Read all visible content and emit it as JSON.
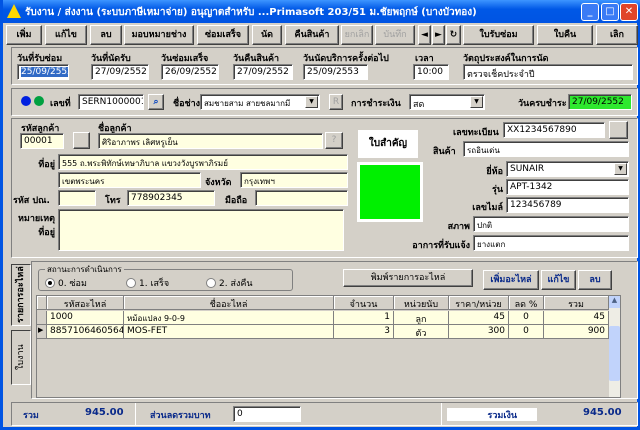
{
  "window": {
    "title": "รับงาน / ส่งงาน (ระบบภาษีเหมาจ่าย) อนุญาตสำหรับ ...Primasoft 203/51 ม.ชัยพฤกษ์ (บางบัวทอง)"
  },
  "toolbar": {
    "add": "เพิ่ม",
    "edit": "แก้ไข",
    "delete": "ลบ",
    "assign_tech": "มอบหมายช่าง",
    "repair_done": "ซ่อมเสร็จ",
    "appointment": "นัด",
    "return_goods": "คืนสินค้า",
    "cancel": "ยกเลิก",
    "save": "บันทึก",
    "prev": "◄",
    "next": "►",
    "refresh": "↻",
    "repair_receipt": "ใบรับซ่อม",
    "return_receipt": "ใบคืน",
    "quit": "เลิก"
  },
  "dates": {
    "received_label": "วันที่รับซ่อม",
    "received": "25/09/2552",
    "pickup_label": "วันที่นัดรับ",
    "pickup": "27/09/2552",
    "repaired_label": "วันซ่อมเสร็จ",
    "repaired": "26/09/2552",
    "returned_label": "วันคืนสินค้า",
    "returned": "27/09/2552",
    "next_service_label": "วันนัดบริการครั้งต่อไป",
    "next_service": "25/09/2553",
    "time_label": "เวลา",
    "time": "10:00",
    "purpose_label": "วัตถุประสงค์ในการนัด",
    "purpose": "ตรวจเช็คประจำปี"
  },
  "job": {
    "number_label": "เลขที่",
    "number": "SERN1000001",
    "tech_label": "ชื่อช่าง",
    "tech": "สมชายสาม สายชลมากมี",
    "payment_label": "การชำระเงิน",
    "payment": "สด",
    "due_label": "วันครบชำระ",
    "due": "27/09/2552"
  },
  "customer": {
    "code_label": "รหัสลูกค้า",
    "code": "00001",
    "name_label": "ชื่อลูกค้า",
    "name": "ศิริอาภาพร เลิศหรูเย็น",
    "help": "?",
    "address_label": "ที่อยู่",
    "address1": "555 ถ.พระพิทักษ์เทษาภิบาล แขวงวังบูรพาภิรมย์",
    "address2": "เขตพระนคร",
    "province_label": "จังหวัด",
    "province": "กรุงเทพฯ",
    "zip_label": "รหัส ปณ.",
    "zip": "",
    "phone_label": "โทร",
    "phone": "778902345",
    "mobile_label": "มือถือ",
    "mobile": "",
    "note_label1": "หมายเหตุ",
    "note_label2": "ที่อยู่",
    "note": ""
  },
  "important_label": "ใบสำคัญ",
  "product": {
    "reg_label": "เลขทะเบียน",
    "reg": "XX1234567890",
    "item_label": "สินค้า",
    "item": "รถอินเด่น",
    "brand_label": "ยี่ห้อ",
    "brand": "SUNAIR",
    "model_label": "รุ่น",
    "model": "APT-1342",
    "mileage_label": "เลขไมล์",
    "mileage": "123456789",
    "condition_label": "สภาพ",
    "condition": "ปกติ",
    "symptom_label": "อาการที่รับแจ้ง",
    "symptom": "ยางแตก"
  },
  "tabs": {
    "parts": "รายการอะไหล่",
    "worksheet": "ใบงาน"
  },
  "status": {
    "label": "สถานะการดำเนินการ",
    "options": [
      "0. ซ่อม",
      "1. เสร็จ",
      "2. ส่งคืน"
    ],
    "selected": 0
  },
  "parts_actions": {
    "print": "พิมพ์รายการอะไหล่",
    "add": "เพิ่มอะไหล่",
    "edit": "แก้ไข",
    "delete": "ลบ"
  },
  "grid": {
    "headers": [
      "รหัสอะไหล่",
      "ชื่ออะไหล่",
      "จำนวน",
      "หน่วยนับ",
      "ราคา/หน่วย",
      "ลด %",
      "รวม"
    ],
    "rows": [
      [
        "1000",
        "หม้อแปลง 9-0-9",
        "1",
        "ลูก",
        "45",
        "0",
        "45"
      ],
      [
        "8857106460564",
        "MOS-FET",
        "3",
        "ตัว",
        "300",
        "0",
        "900"
      ]
    ]
  },
  "footer": {
    "sum_label": "รวม",
    "sum": "945.00",
    "discount_label": "ส่วนลดรวมบาท",
    "discount": "0",
    "total_label": "รวมเงิน",
    "total": "945.00"
  }
}
